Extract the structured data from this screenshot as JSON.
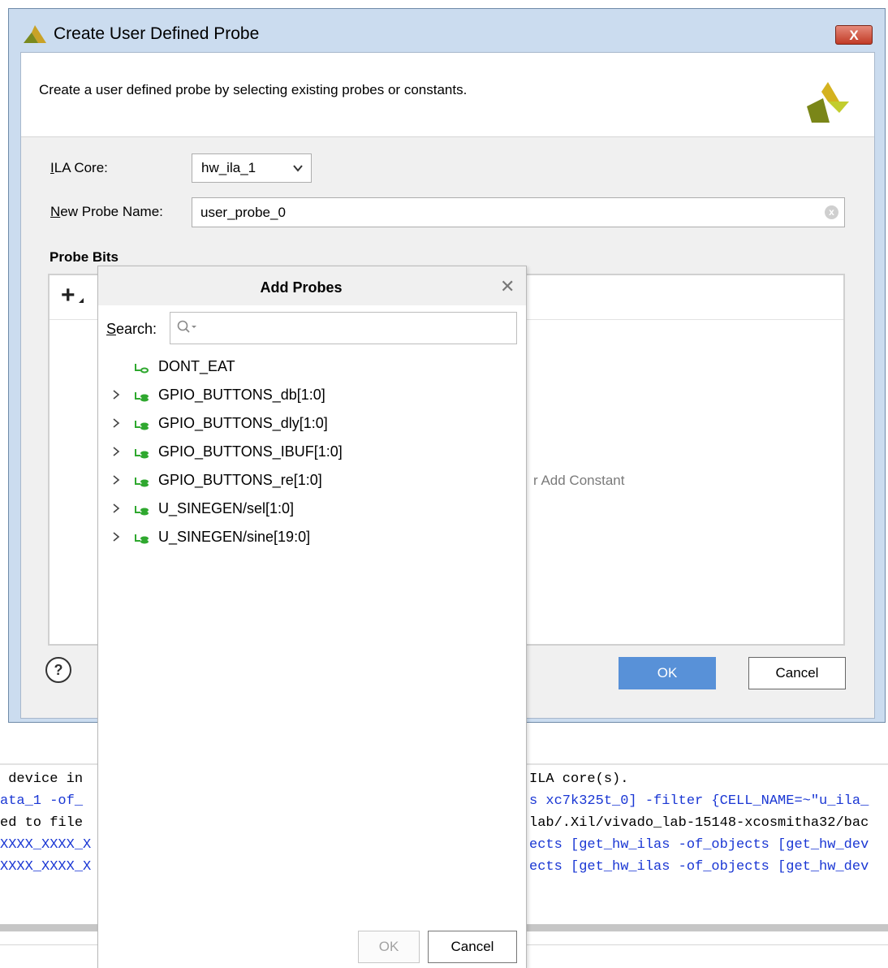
{
  "dialog": {
    "title": "Create User Defined Probe",
    "close_label": "X",
    "description": "Create a user defined probe by selecting existing probes or constants.",
    "ila_core": {
      "label_first": "I",
      "label_rest": "LA Core:",
      "value": "hw_ila_1"
    },
    "probe_name": {
      "label_first": "N",
      "label_rest": "ew Probe Name:",
      "value": "user_probe_0"
    },
    "probe_bits_heading": "Probe Bits",
    "add_button": "+",
    "add_constant_hint": "r Add Constant",
    "help_label": "?",
    "ok_label": "OK",
    "cancel_label": "Cancel"
  },
  "popup": {
    "title": "Add Probes",
    "close_label": "✕",
    "search_label_first": "S",
    "search_label_rest": "earch:",
    "search_value": "",
    "nodes": [
      {
        "name": "DONT_EAT",
        "expandable": false
      },
      {
        "name": "GPIO_BUTTONS_db[1:0]",
        "expandable": true
      },
      {
        "name": "GPIO_BUTTONS_dly[1:0]",
        "expandable": true
      },
      {
        "name": "GPIO_BUTTONS_IBUF[1:0]",
        "expandable": true
      },
      {
        "name": "GPIO_BUTTONS_re[1:0]",
        "expandable": true
      },
      {
        "name": "U_SINEGEN/sel[1:0]",
        "expandable": true
      },
      {
        "name": "U_SINEGEN/sine[19:0]",
        "expandable": true
      }
    ],
    "ok_label": "OK",
    "cancel_label": "Cancel"
  },
  "console": {
    "lines": [
      {
        "left": " device in",
        "right": "ILA core(s).",
        "color": "black"
      },
      {
        "left": "ata_1 -of_",
        "right": "s xc7k325t_0] -filter {CELL_NAME=~\"u_ila_",
        "color": "blue"
      },
      {
        "left": "ed to file",
        "right": "lab/.Xil/vivado_lab-15148-xcosmitha32/bac",
        "color": "black"
      },
      {
        "left": "XXXX_XXXX_X",
        "right": "ects [get_hw_ilas -of_objects [get_hw_dev",
        "color": "blue"
      },
      {
        "left": "XXXX_XXXX_X",
        "right": "ects [get_hw_ilas -of_objects [get_hw_dev",
        "color": "blue"
      }
    ]
  },
  "colors": {
    "accent": "#5891d8",
    "net_icon": "#2fa82f",
    "console_blue": "#1a37d4"
  }
}
